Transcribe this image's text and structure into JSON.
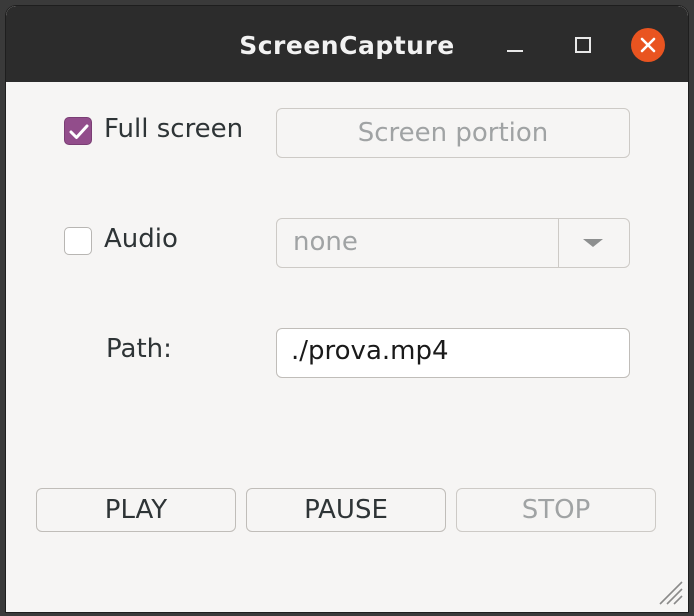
{
  "window": {
    "title": "ScreenCapture"
  },
  "full_screen": {
    "label": "Full screen",
    "checked": true
  },
  "screen_portion_button": {
    "label": "Screen portion",
    "enabled": false
  },
  "audio": {
    "label": "Audio",
    "checked": false,
    "selected_device": "none"
  },
  "path": {
    "label": "Path:",
    "value": "./prova.mp4"
  },
  "controls": {
    "play_label": "PLAY",
    "pause_label": "PAUSE",
    "stop_label": "STOP",
    "stop_enabled": false
  },
  "colors": {
    "accent": "#924d8b",
    "close_button": "#e95420",
    "titlebar": "#2c2c2c",
    "background": "#f6f5f4"
  }
}
